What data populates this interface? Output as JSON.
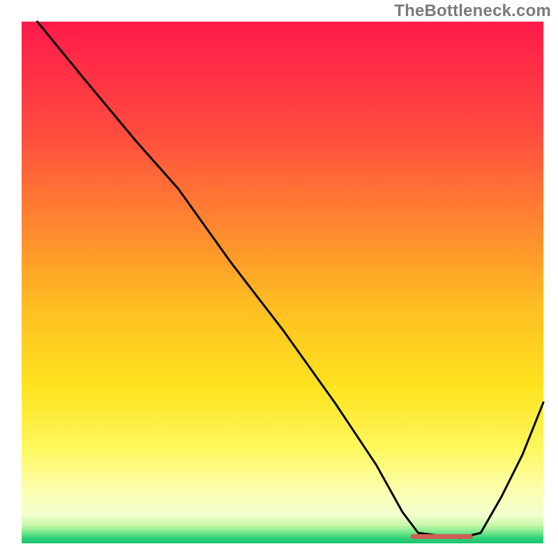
{
  "watermark": "TheBottleneck.com",
  "chart_data": {
    "type": "line",
    "title": "",
    "xlabel": "",
    "ylabel": "",
    "xlim": [
      0,
      100
    ],
    "ylim": [
      0,
      100
    ],
    "grid": false,
    "legend": false,
    "note": "Axes not shown; values are relative positions read off the image (0–100 on both axes, origin at bottom-left of the coloured area). The curve dips to ~0 near the minimum segment and rises again.",
    "gradient_stops": [
      {
        "offset": 0.0,
        "color": "#ff1a4b"
      },
      {
        "offset": 0.2,
        "color": "#ff4840"
      },
      {
        "offset": 0.4,
        "color": "#ff8a2e"
      },
      {
        "offset": 0.55,
        "color": "#ffbf22"
      },
      {
        "offset": 0.7,
        "color": "#ffe31e"
      },
      {
        "offset": 0.82,
        "color": "#fff85f"
      },
      {
        "offset": 0.9,
        "color": "#fbffb0"
      },
      {
        "offset": 0.945,
        "color": "#f3ffcf"
      },
      {
        "offset": 0.965,
        "color": "#c9f7a8"
      },
      {
        "offset": 0.978,
        "color": "#7fe98e"
      },
      {
        "offset": 0.99,
        "color": "#30d27a"
      },
      {
        "offset": 1.0,
        "color": "#17c46f"
      }
    ],
    "series": [
      {
        "name": "curve",
        "x": [
          3,
          12,
          22,
          30,
          40,
          50,
          60,
          68,
          73,
          76,
          84,
          88,
          92,
          96,
          100
        ],
        "y": [
          100,
          89,
          77,
          68,
          54,
          41,
          27,
          15,
          6,
          2,
          1,
          2,
          9,
          17,
          27
        ]
      }
    ],
    "minimum_segment": {
      "description": "flat marker segment near the curve minimum",
      "x_start": 75,
      "x_end": 86,
      "y": 1.3,
      "color": "#cd5f55"
    }
  }
}
